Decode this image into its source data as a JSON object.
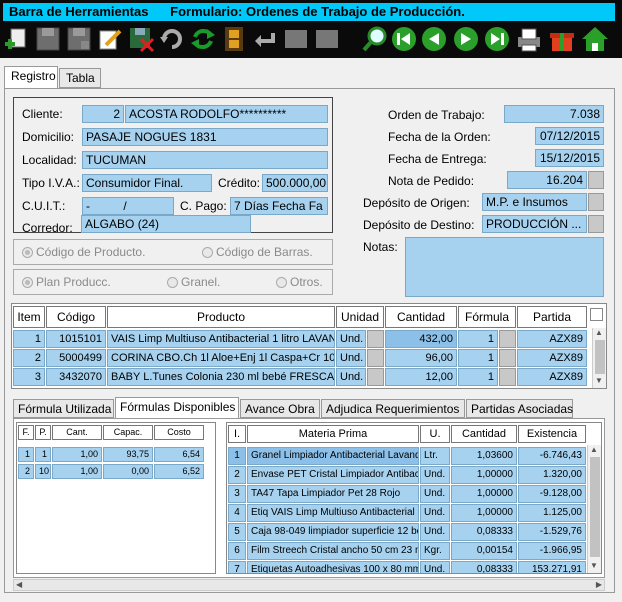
{
  "window": {
    "toolbar_title": "Barra de Herramientas",
    "form_title": "Formulario: Ordenes de Trabajo de Producción."
  },
  "toolbar": {
    "icons": [
      "add-icon",
      "save-icon",
      "save-as-icon",
      "edit-icon",
      "delete-icon",
      "undo-icon",
      "refresh-icon",
      "film-icon",
      "back-arrow-icon",
      "blank-icon",
      "blank-icon",
      "search-icon",
      "first-icon",
      "previous-icon",
      "next-icon",
      "last-icon",
      "print-icon",
      "gift-icon",
      "home-icon"
    ]
  },
  "tabs": [
    "Registro",
    "Tabla"
  ],
  "header": {
    "cliente_label": "Cliente:",
    "cliente_num": "2",
    "cliente_name": "ACOSTA RODOLFO**********",
    "domicilio_label": "Domicilio:",
    "domicilio": "PASAJE NOGUES 1831",
    "localidad_label": "Localidad:",
    "localidad": "TUCUMAN",
    "iva_label": "Tipo I.V.A.:",
    "iva": "Consumidor Final.",
    "credito_label": "Crédito:",
    "credito": "500.000,00",
    "cuit_label": "C.U.I.T.:",
    "cuit": "-          /",
    "cpago_label": "C. Pago:",
    "cpago": "7 Días Fecha Fa",
    "corredor_label": "Corredor:",
    "corredor": "ALGABO (24)",
    "orden_label": "Orden de Trabajo:",
    "orden": "7.038",
    "fecha_orden_label": "Fecha de la Orden:",
    "fecha_orden": "07/12/2015",
    "fecha_entrega_label": "Fecha de Entrega:",
    "fecha_entrega": "15/12/2015",
    "nota_label": "Nota de Pedido:",
    "nota": "16.204",
    "dep_origen_label": "Depósito de Origen:",
    "dep_origen": "M.P. e Insumos",
    "dep_destino_label": "Depósito de Destino:",
    "dep_destino": "PRODUCCIÓN ...",
    "notas_label": "Notas:"
  },
  "radios1": {
    "a": "Código de Producto.",
    "b": "Código de Barras."
  },
  "radios2": {
    "a": "Plan Producc.",
    "b": "Granel.",
    "c": "Otros."
  },
  "items": {
    "headers": [
      "Item",
      "Código",
      "Producto",
      "Unidad",
      "Cantidad",
      "Fórmula",
      "Partida"
    ],
    "rows": [
      [
        "1",
        "1015101",
        "VAIS Limp Multiuso Antibacterial 1 litro LAVAN",
        "Und.",
        "432,00",
        "1",
        "AZX89"
      ],
      [
        "2",
        "5000499",
        "CORINA CBO.Ch 1l  Aloe+Enj 1l Caspa+Cr 100",
        "Und.",
        "96,00",
        "1",
        "AZX89"
      ],
      [
        "3",
        "3432070",
        "BABY L.Tunes Colonia 230 ml bebé FRESCA",
        "Und.",
        "12,00",
        "1",
        "AZX89"
      ]
    ]
  },
  "subtabs": [
    "Fórmula Utilizada",
    "Fórmulas Disponibles",
    "Avance Obra",
    "Adjudica Requerimientos",
    "Partidas Asociadas"
  ],
  "formulas": {
    "headers": [
      "F.",
      "P.",
      "Cant.",
      "Capac.",
      "Costo"
    ],
    "rows": [
      [
        "1",
        "1",
        "1,00",
        "93,75",
        "6,54"
      ],
      [
        "2",
        "10",
        "1,00",
        "0,00",
        "6,52"
      ]
    ]
  },
  "materias": {
    "headers": [
      "I.",
      "Materia Prima",
      "U.",
      "Cantidad",
      "Existencia"
    ],
    "rows": [
      [
        "1",
        "Granel Limpiador Antibacterial Lavanda",
        "Ltr.",
        "1,03600",
        "-6.746,43"
      ],
      [
        "2",
        "Envase PET Cristal Limpiador Antibac",
        "Und.",
        "1,00000",
        "1.320,00"
      ],
      [
        "3",
        "TA47 Tapa Limpiador Pet 28 Rojo",
        "Und.",
        "1,00000",
        "-9.128,00"
      ],
      [
        "4",
        "Etiq VAIS Limp Multiuso Antibacterial L",
        "Und.",
        "1,00000",
        "1.125,00"
      ],
      [
        "5",
        "Caja 98-049 limpiador superficie 12 bo",
        "Und.",
        "0,08333",
        "-1.529,76"
      ],
      [
        "6",
        "Film Streech Cristal ancho 50 cm 23 m",
        "Kgr.",
        "0,00154",
        "-1.966,95"
      ],
      [
        "7",
        "Etiquetas Autoadhesivas 100 x 80 mm",
        "Und.",
        "0,08333",
        "153.271,91"
      ]
    ]
  },
  "colors": {
    "field": "#a6d2f0",
    "title": "#00c8f8",
    "titlebar": "#0a0a0a"
  }
}
